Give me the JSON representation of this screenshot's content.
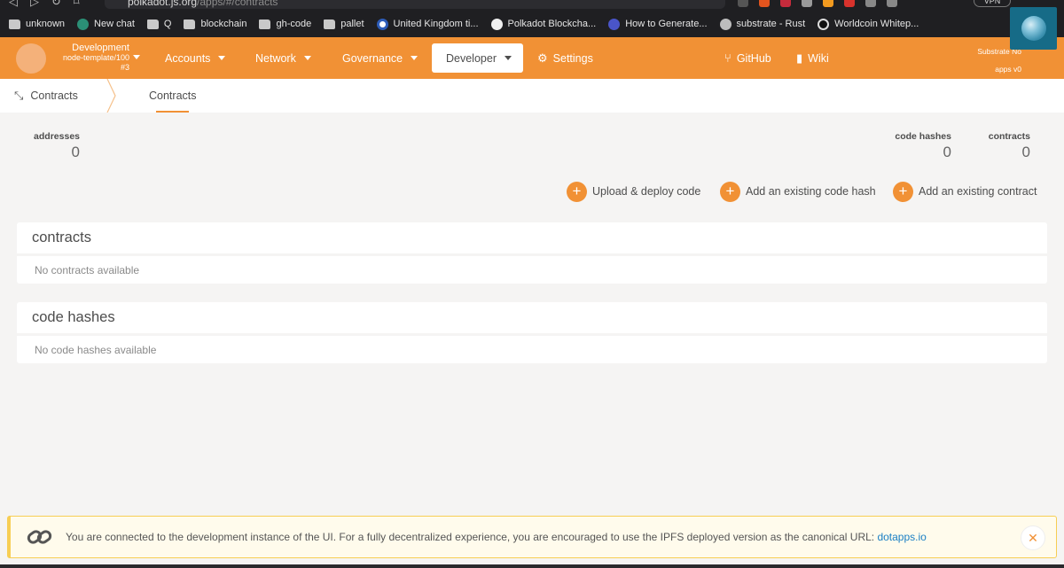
{
  "browser": {
    "url_domain": "polkadot.js.org",
    "url_path": "/apps/#/contracts",
    "vpn_label": "VPN",
    "bookmarks": [
      {
        "label": "unknown",
        "icon": "folder-icon"
      },
      {
        "label": "New chat",
        "icon": "chatgpt-icon"
      },
      {
        "label": "Q",
        "icon": "folder-icon"
      },
      {
        "label": "blockchain",
        "icon": "folder-icon"
      },
      {
        "label": "gh-code",
        "icon": "folder-icon"
      },
      {
        "label": "pallet",
        "icon": "folder-icon"
      },
      {
        "label": "United Kingdom ti...",
        "icon": "clock-icon"
      },
      {
        "label": "Polkadot Blockcha...",
        "icon": "github-icon"
      },
      {
        "label": "How to Generate...",
        "icon": "globe-icon"
      },
      {
        "label": "substrate - Rust",
        "icon": "rust-icon"
      },
      {
        "label": "Worldcoin Whitep...",
        "icon": "worldcoin-icon"
      }
    ]
  },
  "header": {
    "chain_name": "Development",
    "chain_runtime": "node-template/100",
    "chain_block": "#3",
    "menu": {
      "accounts": "Accounts",
      "network": "Network",
      "governance": "Governance",
      "developer": "Developer",
      "settings": "Settings",
      "github": "GitHub",
      "wiki": "Wiki"
    },
    "version_line1": "Substrate No",
    "version_line2": "apps v0"
  },
  "subnav": {
    "section_title": "Contracts",
    "tab": "Contracts"
  },
  "summary": {
    "addresses_label": "addresses",
    "addresses_value": "0",
    "code_hashes_label": "code hashes",
    "code_hashes_value": "0",
    "contracts_label": "contracts",
    "contracts_value": "0"
  },
  "actions": {
    "upload": "Upload & deploy code",
    "add_code_hash": "Add an existing code hash",
    "add_contract": "Add an existing contract"
  },
  "contracts_card": {
    "title": "contracts",
    "empty": "No contracts available"
  },
  "code_hashes_card": {
    "title": "code hashes",
    "empty": "No code hashes available"
  },
  "banner": {
    "message": "You are connected to the development instance of the UI. For a fully decentralized experience, you are encouraged to use the IPFS deployed version as the canonical URL: ",
    "link": "dotapps.io"
  },
  "colors": {
    "accent": "#f19135",
    "logo_bg": "#166b87",
    "banner_border": "#f7ce54",
    "link": "#1a7fc4"
  }
}
